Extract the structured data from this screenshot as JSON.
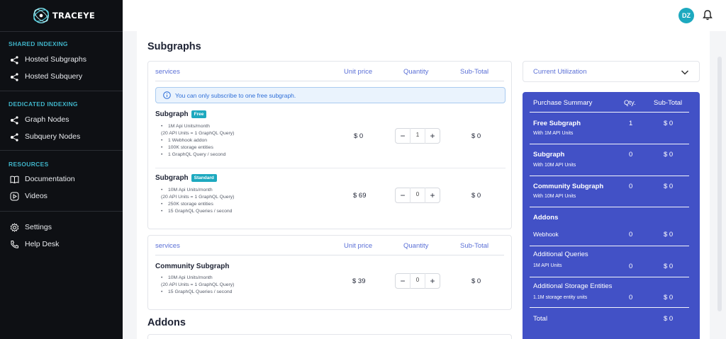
{
  "brand": {
    "name": "TRACEYE"
  },
  "sidebar": {
    "sections": [
      {
        "title": "SHARED INDEXING",
        "items": [
          {
            "label": "Hosted Subgraphs",
            "icon": "graph-icon"
          },
          {
            "label": "Hosted Subquery",
            "icon": "graph-icon"
          }
        ]
      },
      {
        "title": "DEDICATED INDEXING",
        "items": [
          {
            "label": "Graph Nodes",
            "icon": "graph-icon"
          },
          {
            "label": "Subquery Nodes",
            "icon": "graph-icon"
          }
        ]
      },
      {
        "title": "RESOURCES",
        "items": [
          {
            "label": "Documentation",
            "icon": "book-icon"
          },
          {
            "label": "Videos",
            "icon": "play-icon"
          }
        ]
      }
    ],
    "bottom": [
      {
        "label": "Settings",
        "icon": "gear-icon"
      },
      {
        "label": "Help Desk",
        "icon": "phone-icon"
      }
    ]
  },
  "header": {
    "avatar_initials": "DZ"
  },
  "main": {
    "subgraphs_title": "Subgraphs",
    "addons_title": "Addons",
    "table_headers": {
      "services": "services",
      "unit_price": "Unit price",
      "quantity": "Quantity",
      "subtotal": "Sub-Total"
    },
    "info_message": "You can only subscribe to one free subgraph.",
    "plans": [
      {
        "name": "Subgraph",
        "badge": "Free",
        "features": [
          "1M Api Units/month",
          "(20 API Units = 1 GraphQL Query)",
          "1 Webhook addon",
          "100K storage entities",
          "1 GraphQL Query / second"
        ],
        "price": "$ 0",
        "qty": "1",
        "subtotal": "$ 0"
      },
      {
        "name": "Subgraph",
        "badge": "Standard",
        "features": [
          "10M Api Units/month",
          "(20 API Units = 1 GraphQL Query)",
          "250K storage entities",
          "15 GraphQL Queries / second"
        ],
        "price": "$ 69",
        "qty": "0",
        "subtotal": "$ 0"
      }
    ],
    "community": {
      "name": "Community Subgraph",
      "features": [
        "10M Api Units/month",
        "(20 API Units = 1 GraphQL Query)",
        "15 GraphQL Queries / second"
      ],
      "price": "$ 39",
      "qty": "0",
      "subtotal": "$ 0"
    }
  },
  "utilization": {
    "label": "Current Utilization"
  },
  "summary": {
    "headers": {
      "title": "Purchase Summary",
      "qty": "Qty.",
      "subtotal": "Sub-Total"
    },
    "rows": [
      {
        "title": "Free Subgraph",
        "sub": "With 1M API Units",
        "qty": "1",
        "amount": "$ 0"
      },
      {
        "title": "Subgraph",
        "sub": "With 10M API Units",
        "qty": "0",
        "amount": "$ 0"
      },
      {
        "title": "Community Subgraph",
        "sub": "With 10M API Units",
        "qty": "0",
        "amount": "$ 0"
      }
    ],
    "addons_title": "Addons",
    "addons": [
      {
        "title": "Webhook",
        "qty": "0",
        "amount": "$ 0"
      },
      {
        "title": "Additional Queries",
        "sub": "1M API Units",
        "qty": "0",
        "amount": "$ 0"
      },
      {
        "title": "Additional Storage Entities",
        "sub": "1.1M storage entity units",
        "qty": "0",
        "amount": "$ 0"
      }
    ],
    "total_label": "Total",
    "total_amount": "$ 0"
  },
  "colors": {
    "sidebar_bg": "#0e1014",
    "accent": "#1da9bf",
    "summary_bg": "#4251c6",
    "link_blue": "#5a6fd6"
  }
}
